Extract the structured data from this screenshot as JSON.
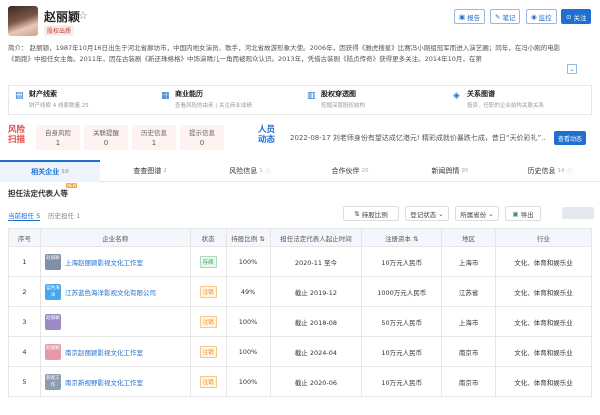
{
  "profile": {
    "name": "赵丽颖",
    "tag": "股权出质",
    "intro": "简介：  赵丽颖，1987年10月16日出生于河北省廊坊市，中国内地女演员、歌手，河北省故游形象大使。2006年，因获得《雅虎搜星》比赛冯小刚组冠军而进入演艺圈；同年，在冯小刚的电影《跑跑》中担任女主角。2011年，因在古装剧《新还珠格格》中饰演晴儿一角而被观众认识。2013年，凭借古装剧《陆贞传奇》获得更多关注。2014年10月，在第",
    "expand_icon": "chevron-down"
  },
  "actions": {
    "report": "报告",
    "notes": "笔记",
    "monitor": "监控",
    "follow": "关注"
  },
  "cards": [
    {
      "title": "财产线索",
      "sub": "财产线索 4   线索数量 25",
      "icon": "money",
      "color": "#1f6fd1"
    },
    {
      "title": "商业能历",
      "sub": "查看风险的由来 | 关注商业成绩",
      "icon": "briefcase",
      "color": "#1f6fd1"
    },
    {
      "title": "股权穿透图",
      "sub": "挖掘深层股权结构",
      "icon": "chart",
      "color": "#1f6fd1"
    },
    {
      "title": "关系图谱",
      "sub": "投资、任职的企业结构关联关系",
      "icon": "network",
      "color": "#1f6fd1"
    }
  ],
  "risk": {
    "title": "风险扫描",
    "items": [
      {
        "label": "自身风险",
        "value": "1"
      },
      {
        "label": "关联提醒",
        "value": "0"
      },
      {
        "label": "历史信息",
        "value": "1"
      },
      {
        "label": "提示信息",
        "value": "0"
      }
    ]
  },
  "news": {
    "title": "人员动态",
    "text": "2022-08-17  刘老师身份有望达成亿港元!  精彩成就价暴跌七成，昔日“天价彩礼”...",
    "button": "查看动态"
  },
  "tabs": [
    {
      "label": "相关企业",
      "count": "10",
      "active": true
    },
    {
      "label": "查查图谱",
      "count": "2",
      "active": false
    },
    {
      "label": "风险信息",
      "count": "1",
      "active": false
    },
    {
      "label": "合作伙伴",
      "count": "20",
      "active": false
    },
    {
      "label": "新闻舆情",
      "count": "95",
      "active": false
    },
    {
      "label": "历史信息",
      "count": "14",
      "active": false
    }
  ],
  "section": {
    "title": "担任法定代表人等",
    "badge": "NEW",
    "subtabs": [
      {
        "label": "当前担任 5",
        "active": true
      },
      {
        "label": "历史担任 1",
        "active": false
      }
    ],
    "filters": [
      "持股比例",
      "登记状态",
      "所属省份",
      "导出"
    ]
  },
  "table": {
    "headers": [
      "序号",
      "企业名称",
      "状态",
      "持股比例",
      "担任法定代表人起止时间",
      "注册资本",
      "地区",
      "行业"
    ],
    "rows": [
      {
        "idx": "1",
        "logo": "赵丽颖",
        "logo_color": "#7f8fa6",
        "name": "上海赵丽颖影视文化工作室",
        "status": "存续",
        "status_type": "ok",
        "ratio": "100%",
        "period": "2020-11 至今",
        "capital": "10万元人民币",
        "region": "上海市",
        "industry": "文化、体育和娱乐业"
      },
      {
        "idx": "2",
        "logo": "蓝色海洋",
        "logo_color": "#4aa7ec",
        "name": "江苏蓝色海洋影视文化有限公司",
        "status": "注销",
        "status_type": "no",
        "ratio": "49%",
        "period": "截止 2019-12",
        "capital": "1000万元人民币",
        "region": "江苏省",
        "industry": "文化、体育和娱乐业"
      },
      {
        "idx": "3",
        "logo": "赵丽颖",
        "logo_color": "#9b8ac4",
        "name": "",
        "status": "注销",
        "status_type": "no",
        "ratio": "100%",
        "period": "截止 2018-08",
        "capital": "50万元人民币",
        "region": "上海市",
        "industry": "文化、体育和娱乐业"
      },
      {
        "idx": "4",
        "logo": "赵丽颖",
        "logo_color": "#e59aa6",
        "name": "南京赵丽颖影视文化工作室",
        "status": "注销",
        "status_type": "no",
        "ratio": "100%",
        "period": "截止 2024-04",
        "capital": "10万元人民币",
        "region": "南京市",
        "industry": "文化、体育和娱乐业"
      },
      {
        "idx": "5",
        "logo": "影视工作",
        "logo_color": "#8c9db5",
        "name": "南京新视野影视文化工作室",
        "status": "注销",
        "status_type": "no",
        "ratio": "100%",
        "period": "截止 2020-06",
        "capital": "10万元人民币",
        "region": "南京市",
        "industry": "文化、体育和娱乐业"
      }
    ]
  }
}
